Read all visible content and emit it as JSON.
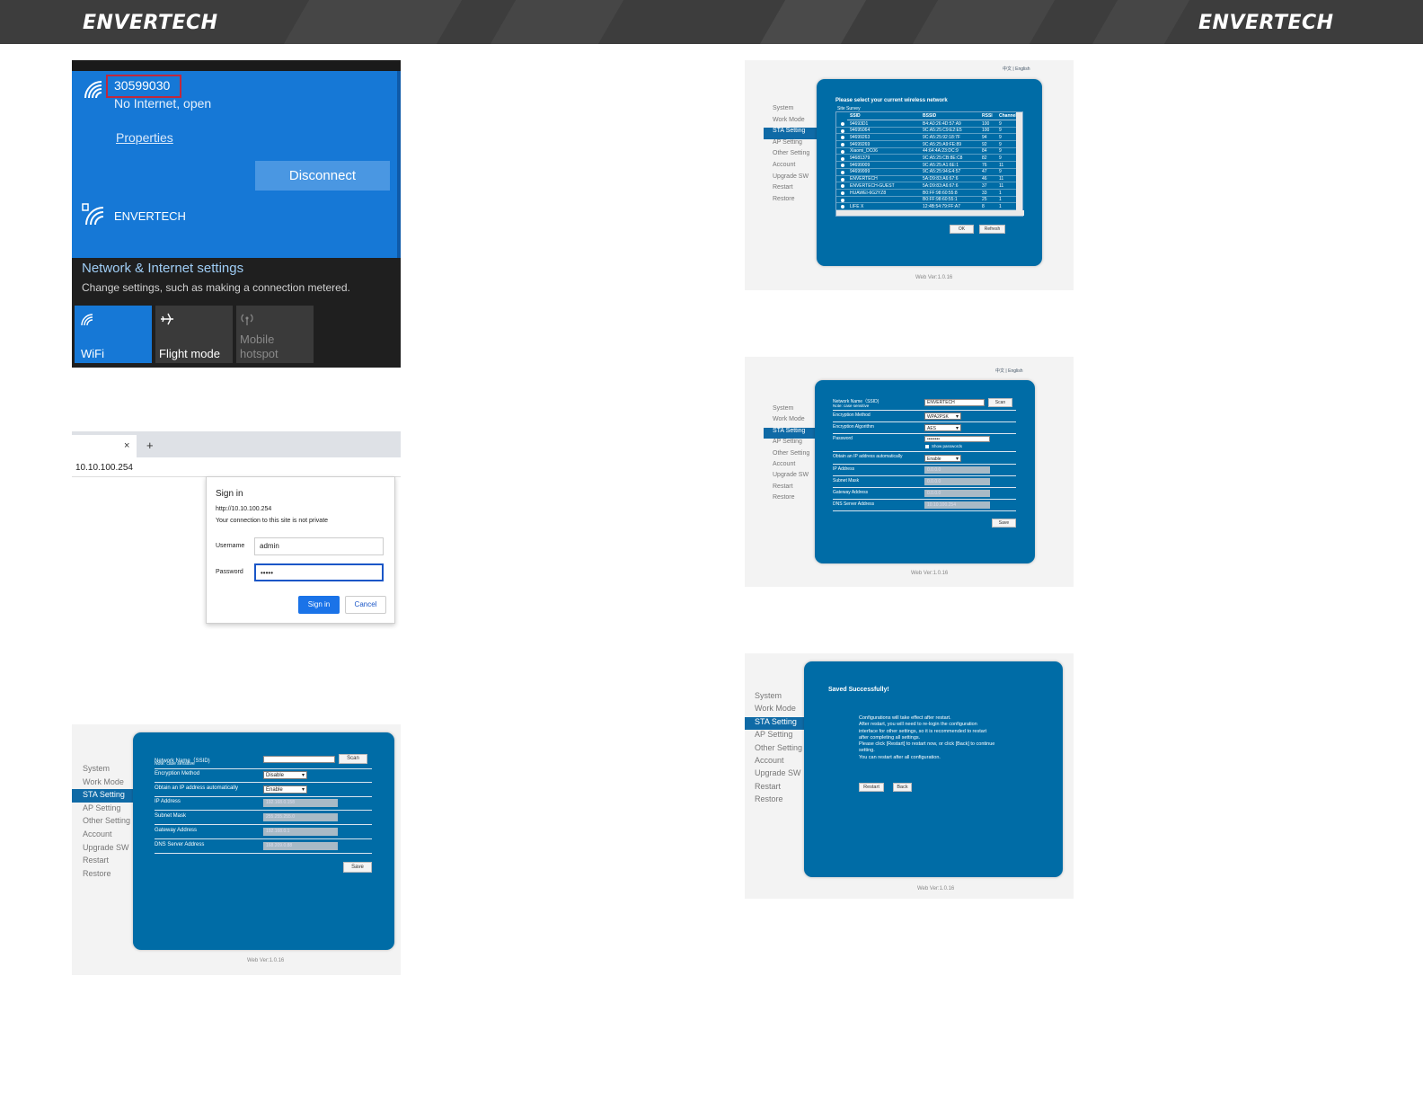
{
  "header": {
    "logo_left": "ENVERTECH",
    "logo_right": "ENVERTECH"
  },
  "wifi_panel": {
    "connected_ssid": "30599030",
    "connected_status": "No Internet, open",
    "properties_link": "Properties",
    "disconnect_button": "Disconnect",
    "other_network": "ENVERTECH",
    "settings_title": "Network & Internet settings",
    "settings_desc": "Change settings, such as making a connection metered.",
    "quick_actions": [
      "WiFi",
      "Flight mode",
      "Mobile hotspot"
    ],
    "colors": {
      "accent": "#1678d6",
      "dark": "#1f1f1f"
    }
  },
  "browser": {
    "close_glyph": "×",
    "new_tab_glyph": "+",
    "url": "10.10.100.254",
    "dialog": {
      "title": "Sign in",
      "url": "http://10.10.100.254",
      "warning": "Your connection to this site is not private",
      "username_label": "Username",
      "username_value": "admin",
      "password_label": "Password",
      "password_value": "•••••",
      "signin_button": "Sign in",
      "cancel_button": "Cancel"
    }
  },
  "nav_items": [
    "System",
    "Work Mode",
    "STA Setting",
    "AP Setting",
    "Other Setting",
    "Account",
    "Upgrade SW",
    "Restart",
    "Restore"
  ],
  "active_nav": "STA Setting",
  "web_version": "Web Ver:1.0.16",
  "lang": {
    "chinese": "中文",
    "sep": "|",
    "english": "English"
  },
  "sta_form_empty": {
    "fields": [
      {
        "label": "Network Name（SSID)",
        "note": "Note: case sensitive",
        "value": ""
      },
      {
        "label": "Encryption Method",
        "value": "Disable"
      },
      {
        "label": "Obtain an IP address automatically",
        "value": "Enable"
      },
      {
        "label": "IP Address",
        "value": "192.168.0.158"
      },
      {
        "label": "Subnet Mask",
        "value": "255.255.255.0"
      },
      {
        "label": "Gateway Address",
        "value": "192.168.0.1"
      },
      {
        "label": "DNS Server Address",
        "value": "168.209.0.88"
      }
    ],
    "scan_button": "Scan",
    "save_button": "Save"
  },
  "site_survey": {
    "title": "Please select your current wireless network",
    "subtitle": "Site Survey",
    "columns": [
      "SSID",
      "BSSID",
      "RSSI",
      "Channel"
    ],
    "rows": [
      [
        "94693D1",
        "B4:A0:26:4D:57:A9",
        "100",
        "9"
      ],
      [
        "94695064",
        "9C:A5:25:C9:E2:E5",
        "100",
        "9"
      ],
      [
        "94699263",
        "9C:A5:25:92:18:7F",
        "94",
        "9"
      ],
      [
        "94699269",
        "9C:A5:25:A9:FE:89",
        "92",
        "9"
      ],
      [
        "Xiaomi_DC06",
        "44:64:4A:23:DC:9",
        "84",
        "9"
      ],
      [
        "94681379",
        "9C:A5:25:CB:8E:C8",
        "82",
        "9"
      ],
      [
        "94699009",
        "9C:A5:25:A1:6E:1",
        "76",
        "11"
      ],
      [
        "94699999",
        "9C:A5:25:94:E4:57",
        "47",
        "9"
      ],
      [
        "ENVERTECH",
        "5A:D9:83:A6:67:6",
        "46",
        "11"
      ],
      [
        "ENVERTECH-GUEST",
        "5A:D9:83:A6:67:6",
        "37",
        "11"
      ],
      [
        "HUAWEI-6G2YZ8",
        "B0:FF:98:60:55:8",
        "33",
        "1"
      ],
      [
        "",
        "B0:FF:98:60:55:1",
        "25",
        "1"
      ],
      [
        "LIFE X",
        "12:4B:54:79:FF:A7",
        "8",
        "1"
      ]
    ],
    "ok_button": "OK",
    "refresh_button": "Refresh"
  },
  "sta_form_filled": {
    "fields": [
      {
        "label": "Network Name（SSID)",
        "note": "Note: case sensitive",
        "value": "ENVERTECH"
      },
      {
        "label": "Encryption Method",
        "value": "WPA2PSK"
      },
      {
        "label": "Encryption Algorithm",
        "value": "AES"
      },
      {
        "label": "Password",
        "value": "••••••••",
        "checkbox": "Show passwords"
      },
      {
        "label": "Obtain an IP address automatically",
        "value": "Enable"
      },
      {
        "label": "IP Address",
        "value": "0.0.0.0"
      },
      {
        "label": "Subnet Mask",
        "value": "0.0.0.0"
      },
      {
        "label": "Gateway Address",
        "value": "0.0.0.0"
      },
      {
        "label": "DNS Server Address",
        "value": "10.10.100.254"
      }
    ],
    "scan_button": "Scan",
    "save_button": "Save"
  },
  "saved": {
    "title": "Saved Successfully!",
    "lines": [
      "Configurations will take effect after restart.",
      "After restart, you will need to re-login the configuration",
      "interface for other settings, so it is recommended to restart",
      "after completing all settings.",
      "Please click [Restart] to restart now, or click [Back] to continue",
      "setting.",
      "You can restart after all configuration."
    ],
    "restart_button": "Restart",
    "back_button": "Back"
  }
}
